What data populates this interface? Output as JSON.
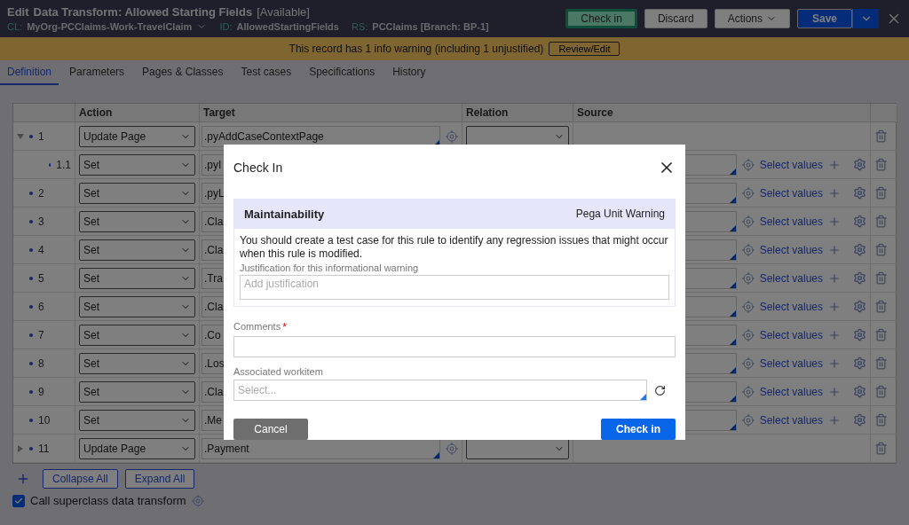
{
  "header": {
    "mode": "Edit",
    "title": "Data Transform: Allowed Starting Fields",
    "status": "[Available]",
    "meta": [
      {
        "label": "CL:",
        "value": "MyOrg-PCClaims-Work-TravelClaim",
        "dropdown": true
      },
      {
        "label": "ID:",
        "value": "AllowedStartingFields",
        "dropdown": false
      },
      {
        "label": "RS:",
        "value": "PCClaims [Branch: BP-1]",
        "dropdown": false
      }
    ],
    "buttons": [
      {
        "label": "Check in",
        "kind": "highlight"
      },
      {
        "label": "Discard",
        "kind": "plain"
      },
      {
        "label": "Actions",
        "kind": "menu"
      },
      {
        "label": "Save",
        "kind": "primary"
      }
    ]
  },
  "warning": {
    "text": "This record has 1 info warning (including 1 unjustified)",
    "button": "Review/Edit"
  },
  "tabs": [
    {
      "label": "Definition",
      "selected": true
    },
    {
      "label": "Parameters",
      "selected": false
    },
    {
      "label": "Pages & Classes",
      "selected": false
    },
    {
      "label": "Test cases",
      "selected": false
    },
    {
      "label": "Specifications",
      "selected": false
    },
    {
      "label": "History",
      "selected": false
    }
  ],
  "table": {
    "columns": [
      "Action",
      "Target",
      "Relation",
      "Source"
    ],
    "rows": [
      {
        "kind": "page",
        "number": "1",
        "expanded": true,
        "action": "Update Page",
        "target": ".pyAddCaseContextPage",
        "children": [
          {
            "kind": "set",
            "number": "1.1",
            "action": "Set",
            "target": ".pyI",
            "select_label": "Select values"
          }
        ]
      },
      {
        "kind": "set",
        "number": "2",
        "action": "Set",
        "target": ".pyL",
        "select_label": "Select values"
      },
      {
        "kind": "set",
        "number": "3",
        "action": "Set",
        "target": ".Cla",
        "select_label": "Select values"
      },
      {
        "kind": "set",
        "number": "4",
        "action": "Set",
        "target": ".Cla",
        "select_label": "Select values"
      },
      {
        "kind": "set",
        "number": "5",
        "action": "Set",
        "target": ".Tra",
        "select_label": "Select values"
      },
      {
        "kind": "set",
        "number": "6",
        "action": "Set",
        "target": ".Cla",
        "select_label": "Select values"
      },
      {
        "kind": "set",
        "number": "7",
        "action": "Set",
        "target": ".Co",
        "select_label": "Select values"
      },
      {
        "kind": "set",
        "number": "8",
        "action": "Set",
        "target": ".Los",
        "select_label": "Select values"
      },
      {
        "kind": "set",
        "number": "9",
        "action": "Set",
        "target": ".Cla",
        "select_label": "Select values"
      },
      {
        "kind": "set",
        "number": "10",
        "action": "Set",
        "target": ".Me",
        "select_label": "Select values"
      },
      {
        "kind": "page",
        "number": "11",
        "expanded": false,
        "action": "Update Page",
        "target": ".Payment",
        "children": []
      }
    ]
  },
  "table_buttons": [
    "Collapse All",
    "Expand All"
  ],
  "superclass": {
    "label": "Call superclass data transform",
    "checked": true
  },
  "dialog": {
    "title": "Check In",
    "warning": {
      "category": "Maintainability",
      "type": "Pega Unit Warning",
      "message": "You should create a test case for this rule to identify any regression issues that might occur when this rule is modified.",
      "justification_label": "Justification for this informational warning",
      "justification_placeholder": "Add justification"
    },
    "comments": {
      "label": "Comments",
      "required_mark": "*"
    },
    "workitem": {
      "label": "Associated workitem",
      "placeholder": "Select..."
    },
    "cancel": "Cancel",
    "submit": "Check in"
  }
}
